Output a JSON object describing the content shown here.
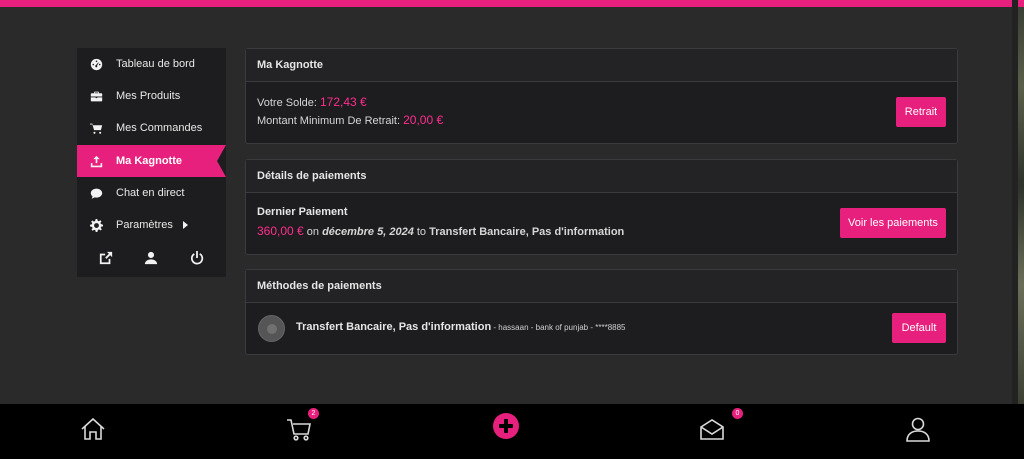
{
  "sidebar": {
    "items": [
      {
        "label": "Tableau de bord",
        "icon": "dashboard-icon"
      },
      {
        "label": "Mes Produits",
        "icon": "briefcase-icon"
      },
      {
        "label": "Mes Commandes",
        "icon": "cart-icon"
      },
      {
        "label": "Ma Kagnotte",
        "icon": "upload-icon",
        "active": true
      },
      {
        "label": "Chat en direct",
        "icon": "chat-icon"
      },
      {
        "label": "Paramètres",
        "icon": "gear-icon"
      }
    ]
  },
  "wallet": {
    "title": "Ma Kagnotte",
    "balance_label": "Votre Solde: ",
    "balance_value": "172,43 €",
    "min_label": "Montant Minimum De Retrait: ",
    "min_value": "20,00 €",
    "withdraw_button": "Retrait"
  },
  "payments": {
    "title": "Détails de paiements",
    "last_label": "Dernier Paiement",
    "amount": "360,00 €",
    "on": " on ",
    "date": "décembre 5, 2024",
    "to": " to ",
    "method": "Transfert Bancaire, Pas d'information",
    "view_button": "Voir les paiements"
  },
  "methods": {
    "title": "Méthodes de paiements",
    "name": "Transfert Bancaire, Pas d'information",
    "details": " - hassaan - bank of punjab - ****8885",
    "default_button": "Default"
  },
  "bottom_nav": {
    "cart_count": "2",
    "inbox_count": "0"
  },
  "colors": {
    "accent": "#e8207d",
    "background": "#2a2a2a",
    "card": "#1d1d20"
  }
}
